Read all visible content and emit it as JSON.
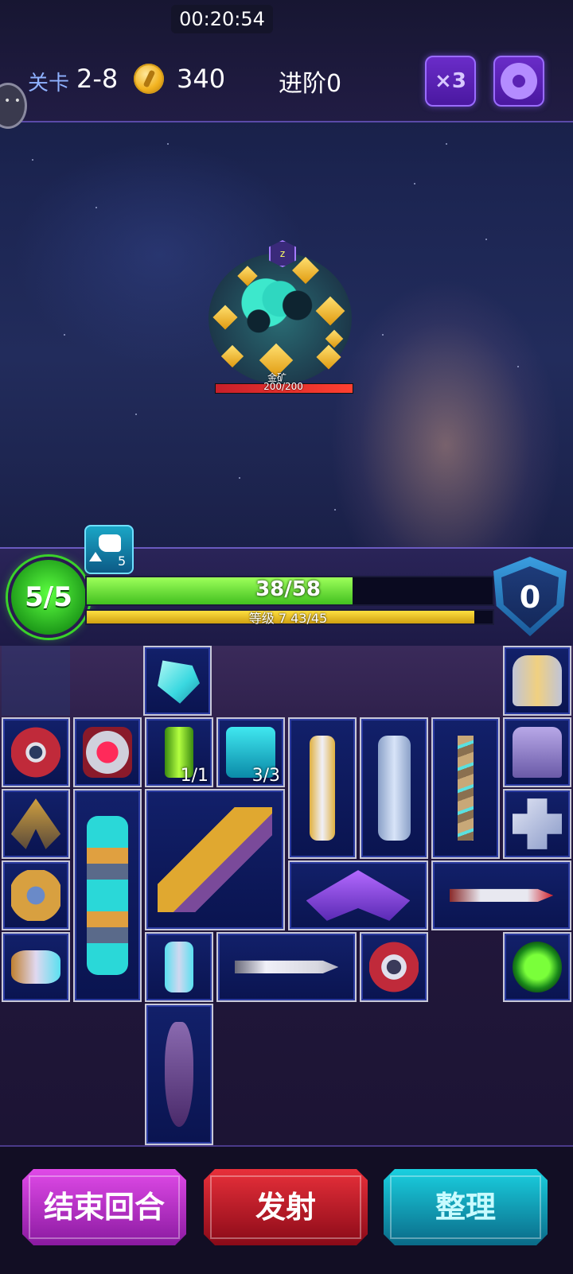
{
  "status_bar": {
    "time": "00:20:54"
  },
  "header": {
    "level_label": "关卡",
    "level_value": "2-8",
    "coins": "340",
    "advance": "进阶0",
    "speed_label": "×3"
  },
  "enemy": {
    "name": "金矿",
    "hp_text": "200/200",
    "hp_fraction": 1.0
  },
  "player": {
    "energy": "5/5",
    "attack_bonus": "5",
    "hp_text": "38/58",
    "hp_fraction": 0.6552,
    "xp_text": "等级 7  43/45",
    "xp_fraction": 0.9556,
    "shield": "0"
  },
  "inventory": {
    "quantities": {
      "green_canister": "1/1",
      "cyan_box": "3/3"
    }
  },
  "buttons": {
    "end_turn": "结束回合",
    "fire": "发射",
    "sort": "整理"
  }
}
